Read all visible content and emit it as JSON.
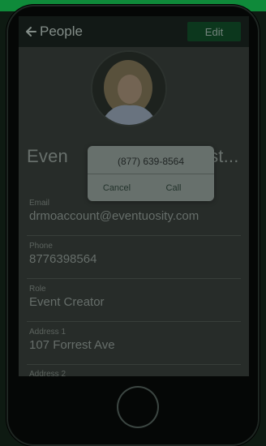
{
  "nav": {
    "back_label": "People",
    "edit_label": "Edit"
  },
  "profile": {
    "name_left": "Even",
    "name_right": "ist..."
  },
  "fields": [
    {
      "label": "Email",
      "value": "drmoaccount@eventuosity.com"
    },
    {
      "label": "Phone",
      "value": "8776398564"
    },
    {
      "label": "Role",
      "value": "Event Creator"
    },
    {
      "label": "Address 1",
      "value": "107 Forrest Ave"
    },
    {
      "label": "Address 2",
      "value": ""
    }
  ],
  "dialog": {
    "number": "(877) 639-8564",
    "cancel_label": "Cancel",
    "call_label": "Call"
  },
  "icons": {
    "back": "arrow-left-icon"
  },
  "colors": {
    "accent": "#0f8a3a",
    "edit_button_bg": "#0d3a1f"
  }
}
